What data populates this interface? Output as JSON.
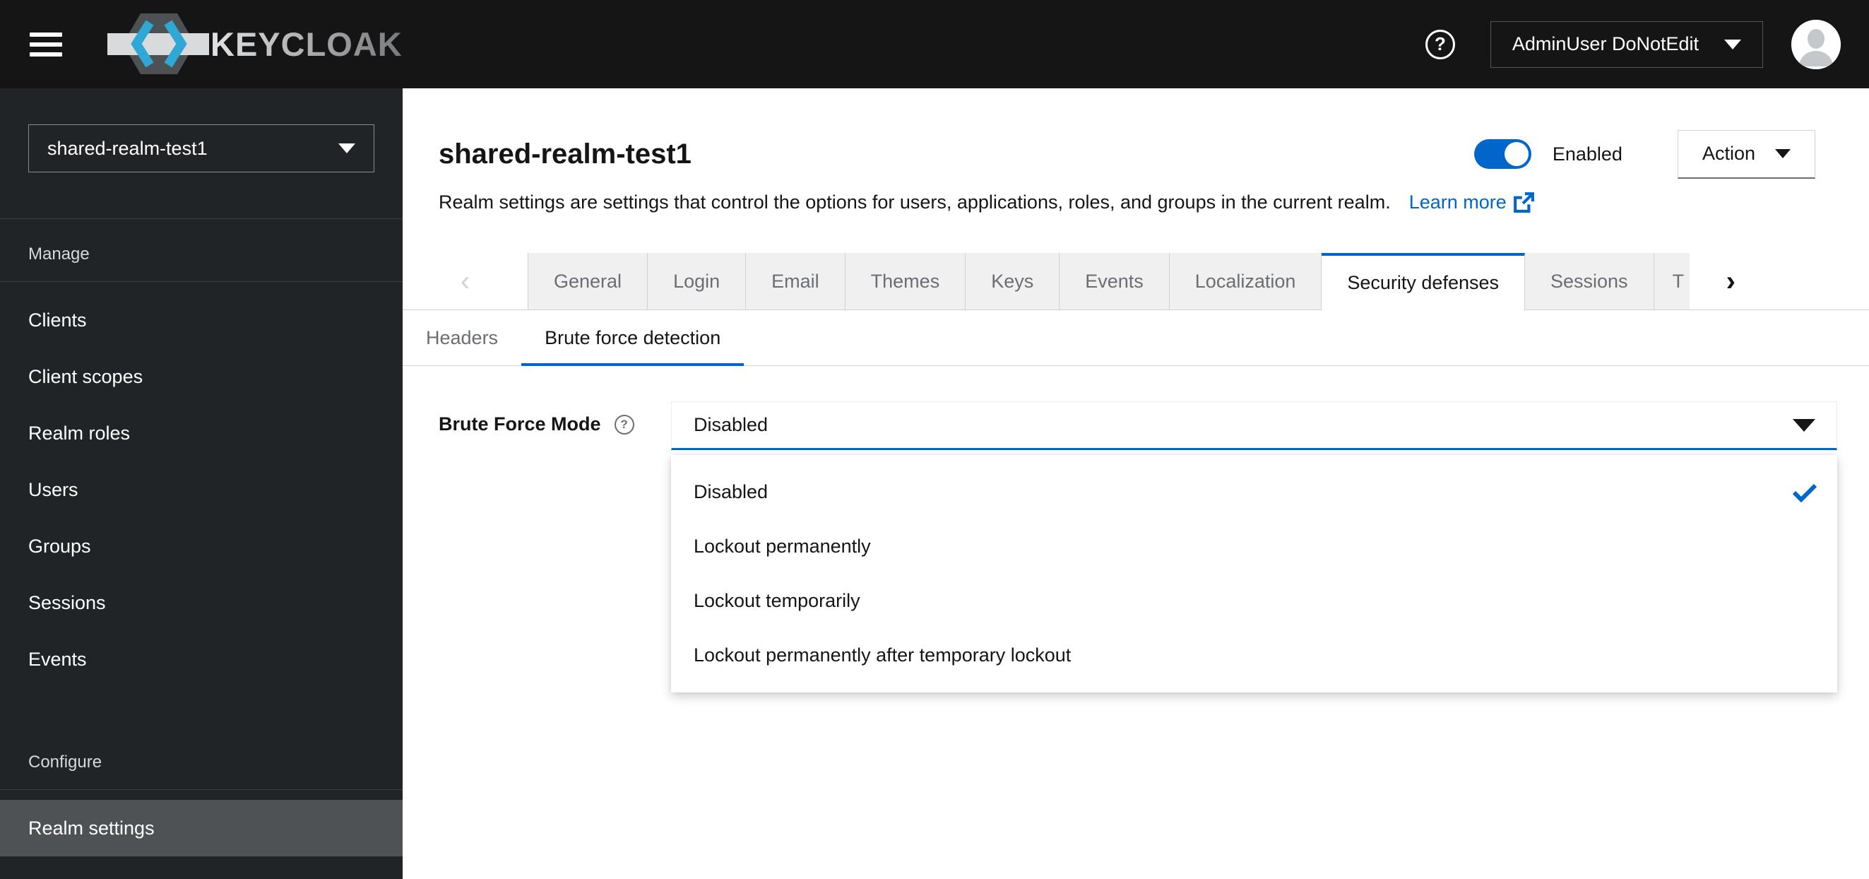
{
  "colors": {
    "accent_blue": "#0066cc",
    "masthead_bg": "#151515",
    "sidebar_bg": "#212427",
    "sidebar_active_bg": "#4f5255",
    "tab_inactive_bg": "#f0f0f0",
    "tab_border": "#d2d2d2",
    "muted_text": "#6a6e73"
  },
  "icons": {
    "help": "?",
    "angle_left": "‹",
    "angle_right": "›"
  },
  "masthead": {
    "logo_text": "KEYCLOAK",
    "user_menu": {
      "label": "AdminUser DoNotEdit"
    }
  },
  "sidebar": {
    "realm_selector": {
      "value": "shared-realm-test1"
    },
    "sections": [
      {
        "title": "Manage",
        "items": [
          {
            "label": "Clients"
          },
          {
            "label": "Client scopes"
          },
          {
            "label": "Realm roles"
          },
          {
            "label": "Users"
          },
          {
            "label": "Groups"
          },
          {
            "label": "Sessions"
          },
          {
            "label": "Events"
          }
        ]
      },
      {
        "title": "Configure",
        "items": [
          {
            "label": "Realm settings",
            "active": true
          }
        ]
      }
    ]
  },
  "header": {
    "title": "shared-realm-test1",
    "description": "Realm settings are settings that control the options for users, applications, roles, and groups in the current realm.",
    "learn_more_label": "Learn more",
    "toggle": {
      "state": "on",
      "label": "Enabled"
    },
    "action_button_label": "Action"
  },
  "tabs": {
    "items": [
      {
        "label": "General"
      },
      {
        "label": "Login"
      },
      {
        "label": "Email"
      },
      {
        "label": "Themes"
      },
      {
        "label": "Keys"
      },
      {
        "label": "Events"
      },
      {
        "label": "Localization"
      },
      {
        "label": "Security defenses",
        "active": true
      },
      {
        "label": "Sessions"
      },
      {
        "label": "T",
        "truncated": true
      }
    ]
  },
  "subtabs": {
    "items": [
      {
        "label": "Headers"
      },
      {
        "label": "Brute force detection",
        "active": true
      }
    ]
  },
  "form": {
    "field_label": "Brute Force Mode",
    "select_value": "Disabled",
    "options": [
      {
        "label": "Disabled",
        "selected": true
      },
      {
        "label": "Lockout permanently",
        "selected": false
      },
      {
        "label": "Lockout temporarily",
        "selected": false
      },
      {
        "label": "Lockout permanently after temporary lockout",
        "selected": false
      }
    ]
  }
}
